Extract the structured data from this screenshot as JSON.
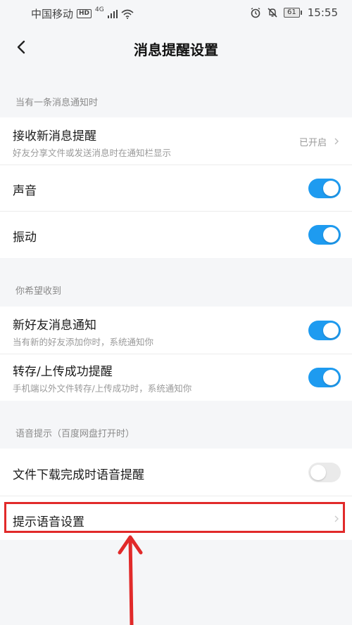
{
  "status_bar": {
    "carrier": "中国移动",
    "hd_badge": "HD",
    "network": "4G",
    "battery": "61",
    "time": "15:55",
    "icons": [
      "signal-icon",
      "wifi-icon",
      "alarm-icon",
      "mute-icon",
      "battery-icon"
    ]
  },
  "header": {
    "title": "消息提醒设置",
    "back_icon": "back-chevron-icon"
  },
  "sections": {
    "single_notice_label": "当有一条消息通知时",
    "wish_label": "你希望收到",
    "voice_label": "语音提示（百度网盘打开时）"
  },
  "rows": {
    "receive": {
      "title": "接收新消息提醒",
      "subtitle": "好友分享文件或发送消息时在通知栏显示",
      "value": "已开启"
    },
    "sound": {
      "title": "声音",
      "enabled": true
    },
    "vibrate": {
      "title": "振动",
      "enabled": true
    },
    "new_friend": {
      "title": "新好友消息通知",
      "subtitle": "当有新的好友添加你时，系统通知你",
      "enabled": true
    },
    "transfer": {
      "title": "转存/上传成功提醒",
      "subtitle": "手机端以外文件转存/上传成功时，系统通知你",
      "enabled": true
    },
    "download_voice": {
      "title": "文件下载完成时语音提醒",
      "enabled": false
    },
    "voice_settings": {
      "title": "提示语音设置"
    }
  },
  "annotation": {
    "highlight_color": "#e12a2a",
    "accent": "#1e9bf0"
  }
}
